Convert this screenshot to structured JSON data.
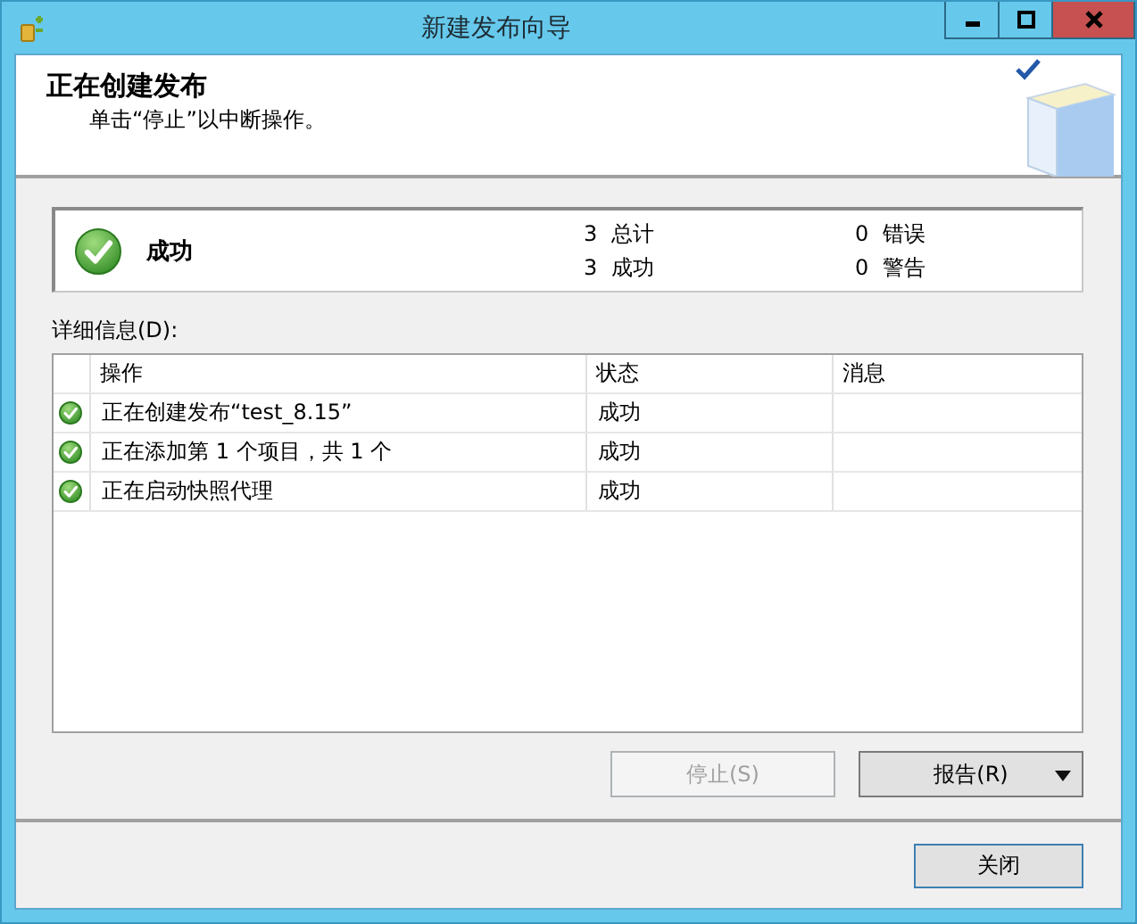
{
  "window": {
    "title": "新建发布向导"
  },
  "header": {
    "title": "正在创建发布",
    "subtitle": "单击“停止”以中断操作。"
  },
  "summary": {
    "status": "成功",
    "kind": "success",
    "counts": [
      "3  总计",
      "0  错误",
      "3  成功",
      "0  警告"
    ]
  },
  "details_label": "详细信息(D):",
  "table": {
    "columns": [
      "操作",
      "状态",
      "消息"
    ],
    "rows": [
      {
        "kind": "success",
        "action": "正在创建发布“test_8.15”",
        "status": "成功"
      },
      {
        "kind": "success",
        "action": "正在添加第 1 个项目，共 1 个",
        "status": "成功"
      },
      {
        "kind": "success",
        "action": "正在启动快照代理",
        "status": "成功"
      }
    ]
  },
  "buttons": [
    {
      "label": "停止(S)",
      "disabled": true
    },
    {
      "label": "报告(R)",
      "disabled": false,
      "dropdown": true
    }
  ],
  "footer_buttons": [
    {
      "label": "关闭",
      "disabled": false
    }
  ]
}
